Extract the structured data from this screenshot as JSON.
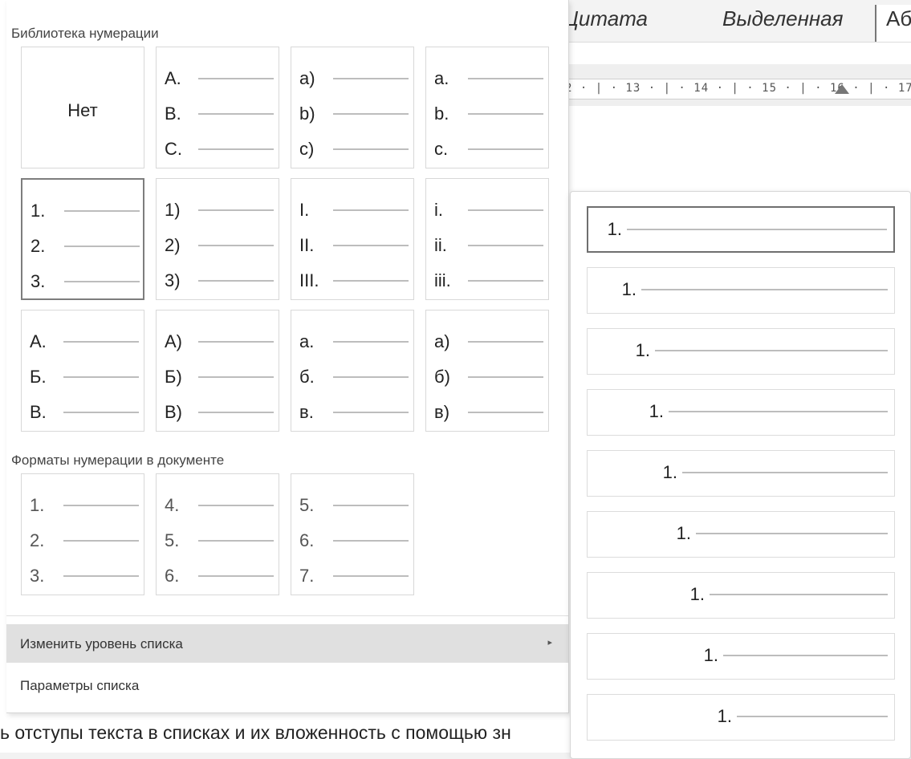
{
  "doc": {
    "styles": [
      "Цитата",
      "Выделенная",
      "Аб"
    ],
    "ruler": "2 · | · 13 · | · 14 · | · 15 · | · 16 · | · 17 ·",
    "body_text": "ь отступы текста в списках и их вложенность с помощью зн"
  },
  "menu": {
    "library_title": "Библиотека нумерации",
    "none_label": "Нет",
    "library": [
      [
        "A.",
        "B.",
        "C."
      ],
      [
        "a)",
        "b)",
        "c)"
      ],
      [
        "a.",
        "b.",
        "c."
      ],
      [
        "1.",
        "2.",
        "3."
      ],
      [
        "1)",
        "2)",
        "3)"
      ],
      [
        "I.",
        "II.",
        "III."
      ],
      [
        "i.",
        "ii.",
        "iii."
      ],
      [
        "А.",
        "Б.",
        "В."
      ],
      [
        "А)",
        "Б)",
        "В)"
      ],
      [
        "а.",
        "б.",
        "в."
      ],
      [
        "а)",
        "б)",
        "в)"
      ]
    ],
    "doc_title": "Форматы нумерации в документе",
    "doc_formats": [
      [
        "1.",
        "2.",
        "3."
      ],
      [
        "4.",
        "5.",
        "6."
      ],
      [
        "5.",
        "6.",
        "7."
      ]
    ],
    "change_level": "Изменить уровень списка",
    "list_params": "Параметры списка"
  },
  "levels": [
    "1.",
    "1.",
    "1.",
    "1.",
    "1.",
    "1.",
    "1.",
    "1.",
    "1."
  ],
  "active_level": 1
}
